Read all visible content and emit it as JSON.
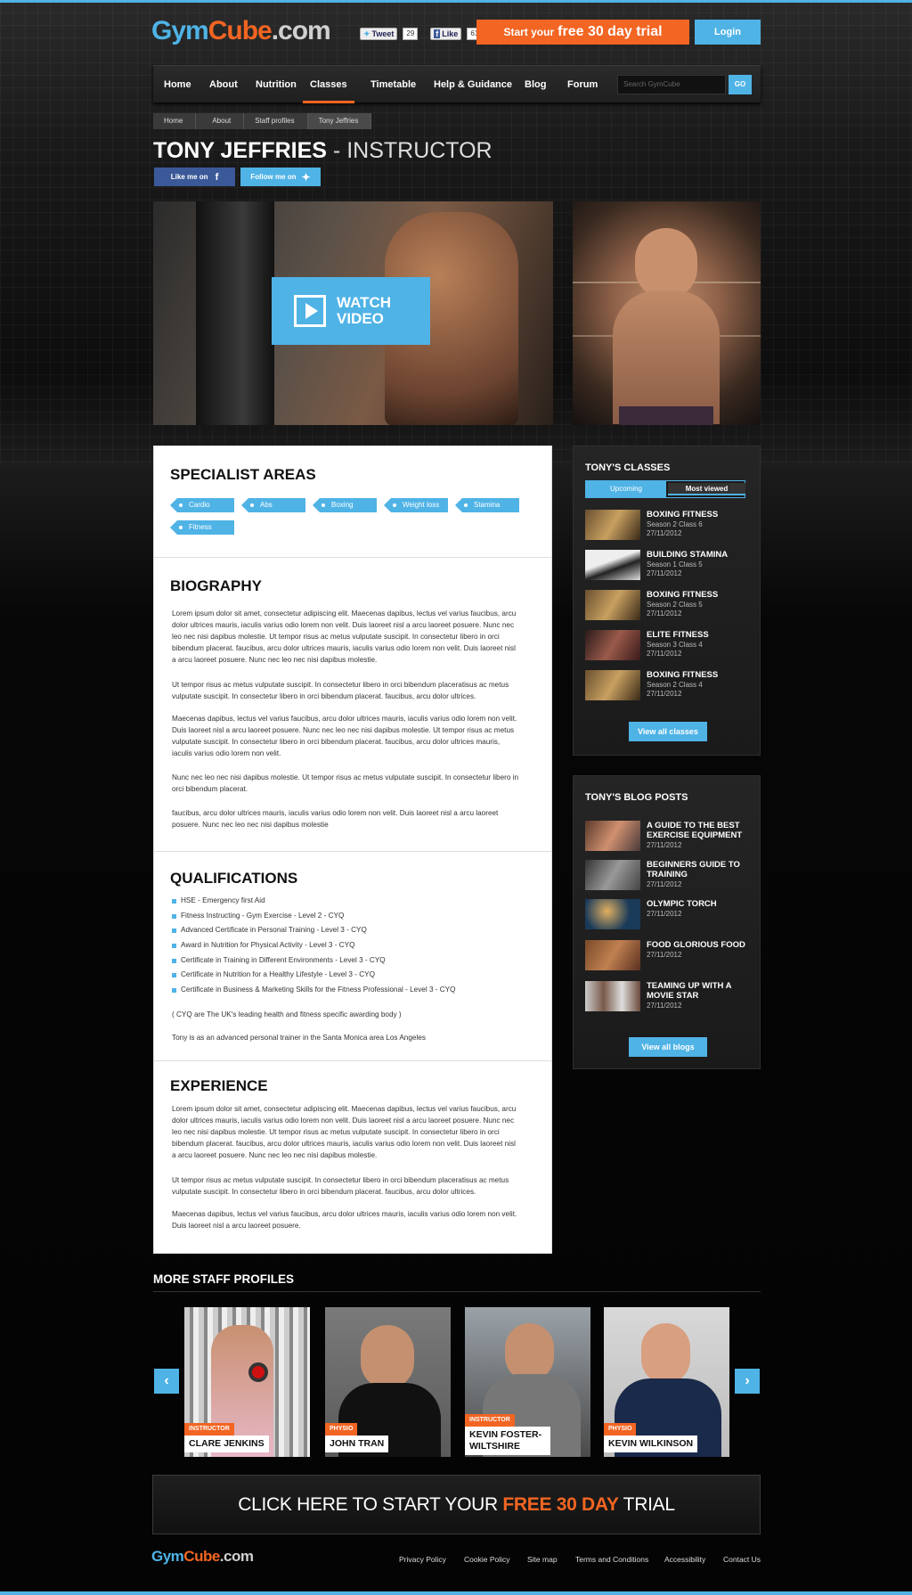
{
  "brand": {
    "logo_part1": "Gym",
    "logo_part2": "Cube",
    "logo_part3": ".com"
  },
  "header": {
    "tweet_label": "Tweet",
    "tweet_count": "29",
    "like_label": "Like",
    "like_count": "61",
    "trial_prefix": "Start your",
    "trial_highlight": "free 30 day trial",
    "login_label": "Login"
  },
  "nav": {
    "items": [
      "Home",
      "About",
      "Nutrition",
      "Classes",
      "Timetable",
      "Help & Guidance",
      "Blog",
      "Forum"
    ],
    "active": "Classes",
    "search_placeholder": "Search GymCube",
    "go_label": "GO"
  },
  "breadcrumb": [
    "Home",
    "About",
    "Staff profiles",
    "Tony Jeffries"
  ],
  "profile": {
    "name": "TONY JEFFRIES",
    "separator": " - ",
    "role": "INSTRUCTOR",
    "facebook_label": "Like me on",
    "twitter_label": "Follow me on",
    "video_label_1": "WATCH",
    "video_label_2": "VIDEO"
  },
  "specialist": {
    "heading": "SPECIALIST AREAS",
    "tags": [
      "Cardio",
      "Abs",
      "Boxing",
      "Weight loss",
      "Stamina",
      "Fitness"
    ]
  },
  "biography": {
    "heading": "BIOGRAPHY",
    "paragraphs": [
      "Lorem ipsum dolor sit amet, consectetur adipiscing elit. Maecenas dapibus, lectus vel varius faucibus, arcu dolor ultrices mauris, iaculis varius odio lorem non velit. Duis laoreet nisl a arcu laoreet posuere. Nunc nec leo nec nisi dapibus molestie. Ut tempor risus ac metus vulputate suscipit. In consectetur libero in orci bibendum placerat. faucibus, arcu dolor ultrices mauris, iaculis varius odio lorem non velit. Duis laoreet nisl a arcu laoreet posuere. Nunc nec leo nec nisi dapibus molestie.",
      "Ut tempor risus ac metus vulputate suscipit. In consectetur libero in orci bibendum placeratisus ac metus vulputate suscipit. In consectetur libero in orci bibendum placerat. faucibus, arcu dolor ultrices.",
      "Maecenas dapibus, lectus vel varius faucibus, arcu dolor ultrices mauris, iaculis varius odio lorem non velit. Duis laoreet nisl a arcu laoreet posuere. Nunc nec leo nec nisi dapibus molestie. Ut tempor risus ac metus vulputate suscipit. In consectetur libero in orci bibendum placerat. faucibus, arcu dolor ultrices mauris, iaculis varius odio lorem non velit.",
      "Nunc nec leo nec nisi dapibus molestie. Ut tempor risus ac metus vulputate suscipit. In consectetur libero in orci bibendum placerat.",
      "faucibus, arcu dolor ultrices mauris, iaculis varius odio lorem non velit. Duis laoreet nisl a arcu laoreet posuere. Nunc nec leo nec nisi dapibus molestie"
    ]
  },
  "qualifications": {
    "heading": "QUALIFICATIONS",
    "items": [
      "HSE - Emergency first Aid",
      "Fitness Instructing - Gym Exercise - Level 2 - CYQ",
      "Advanced Certificate in Personal Training - Level 3 - CYQ",
      "Award in Nutrition for Physical Activity - Level 3 - CYQ",
      "Certificate in Training in Different Environments -  Level 3 - CYQ",
      "Certificate in Nutrition for a Healthy Lifestyle - Level 3 - CYQ",
      "Certificate in Business & Marketing Skills for the Fitness Professional - Level 3 - CYQ"
    ],
    "note": "( CYQ are The UK's leading health and fitness specific awarding body )",
    "location": "Tony is as an advanced personal trainer in the Santa Monica area Los Angeles"
  },
  "experience": {
    "heading": "EXPERIENCE",
    "paragraphs": [
      "Lorem ipsum dolor sit amet, consectetur adipiscing elit. Maecenas dapibus, lectus vel varius faucibus, arcu dolor ultrices mauris, iaculis varius odio lorem non velit. Duis laoreet nisl a arcu laoreet posuere. Nunc nec leo nec nisi dapibus molestie. Ut tempor risus ac metus vulputate suscipit. In consectetur libero in orci bibendum placerat. faucibus, arcu dolor ultrices mauris, iaculis varius odio lorem non velit. Duis laoreet nisl a arcu laoreet posuere. Nunc nec leo nec nisi dapibus molestie.",
      "Ut tempor risus ac metus vulputate suscipit. In consectetur libero in orci bibendum placeratisus ac metus vulputate suscipit. In consectetur libero in orci bibendum placerat. faucibus, arcu dolor ultrices.",
      "Maecenas dapibus, lectus vel varius faucibus, arcu dolor ultrices mauris, iaculis varius odio lorem non velit. Duis laoreet nisl a arcu laoreet posuere."
    ]
  },
  "classes": {
    "heading": "TONY'S CLASSES",
    "tab_upcoming": "Upcoming",
    "tab_most_viewed": "Most viewed",
    "items": [
      {
        "name": "BOXING FITNESS",
        "sub": "Season 2 Class 6",
        "date": "27/11/2012"
      },
      {
        "name": "BUILDING STAMINA",
        "sub": "Season 1 Class 5",
        "date": "27/11/2012"
      },
      {
        "name": "BOXING FITNESS",
        "sub": "Season 2 Class 5",
        "date": "27/11/2012"
      },
      {
        "name": "ELITE FITNESS",
        "sub": "Season 3 Class 4",
        "date": "27/11/2012"
      },
      {
        "name": "BOXING FITNESS",
        "sub": "Season 2 Class 4",
        "date": "27/11/2012"
      }
    ],
    "view_all": "View all classes"
  },
  "blog": {
    "heading": "TONY'S BLOG POSTS",
    "items": [
      {
        "name": "A GUIDE TO THE BEST EXERCISE EQUIPMENT",
        "date": "27/11/2012"
      },
      {
        "name": "BEGINNERS GUIDE TO TRAINING",
        "date": "27/11/2012"
      },
      {
        "name": "OLYMPIC TORCH",
        "date": "27/11/2012"
      },
      {
        "name": "FOOD GLORIOUS FOOD",
        "date": "27/11/2012"
      },
      {
        "name": "TEAMING UP WITH A MOVIE STAR",
        "date": "27/11/2012"
      }
    ],
    "view_all": "View all blogs"
  },
  "more_staff": {
    "heading": "MORE STAFF PROFILES",
    "profiles": [
      {
        "role": "INSTRUCTOR",
        "name": "CLARE JENKINS"
      },
      {
        "role": "PHYSIO",
        "name": "JOHN TRAN"
      },
      {
        "role": "INSTRUCTOR",
        "name": "KEVIN FOSTER-WILTSHIRE"
      },
      {
        "role": "PHYSIO",
        "name": "KEVIN WILKINSON"
      }
    ],
    "prev_icon": "‹",
    "next_icon": "›"
  },
  "cta": {
    "prefix": "CLICK HERE TO START YOUR ",
    "highlight": "FREE 30 DAY",
    "suffix": " TRIAL"
  },
  "footer": {
    "links": [
      "Privacy Policy",
      "Cookie Policy",
      "Site map",
      "Terms and Conditions",
      "Accessibility",
      "Contact Us"
    ]
  },
  "colors": {
    "accent_blue": "#4fb3e6",
    "accent_orange": "#f26522",
    "background": "#0a0a0a"
  }
}
